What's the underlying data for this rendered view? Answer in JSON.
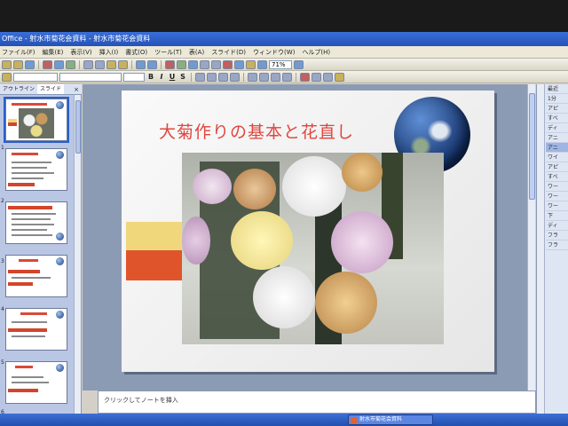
{
  "window": {
    "title": "Office - 射水市菊花会資料 - 射水市菊花会資料"
  },
  "menu": {
    "items": [
      "ファイル(F)",
      "編集(E)",
      "表示(V)",
      "挿入(I)",
      "書式(O)",
      "ツール(T)",
      "表(A)",
      "スライド(D)",
      "ウィンドウ(W)",
      "ヘルプ(H)"
    ]
  },
  "toolbar": {
    "zoom": "71%",
    "bold_label": "B",
    "italic_label": "I",
    "underline_label": "U",
    "strike_label": "S"
  },
  "leftpane": {
    "tabs": [
      "アウトライン",
      "スライド"
    ],
    "close": "×",
    "slide_numbers": [
      "1",
      "2",
      "3",
      "4",
      "5",
      "6"
    ]
  },
  "slide": {
    "title": "大菊作りの基本と花直し"
  },
  "notes": {
    "placeholder": "クリックしてノートを挿入"
  },
  "rightpane": {
    "items": [
      "最近",
      "1分",
      "アピ",
      "すべ",
      "ディ",
      "アニ",
      "アニ",
      "ワイ",
      "アピ",
      "すべ",
      "ワー",
      "ワー",
      "ワー",
      "下",
      "ディ",
      "フラ",
      "フラ"
    ]
  },
  "taskbar": {
    "window_button": "射水市菊花会資料"
  },
  "colors": {
    "title_red": "#e0463e",
    "accent_yellow": "#f1d77c",
    "accent_red": "#e0542c",
    "titlebar_blue": "#2451b8"
  }
}
